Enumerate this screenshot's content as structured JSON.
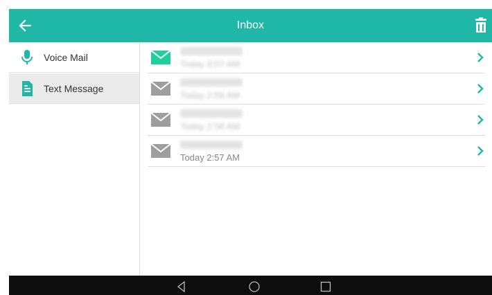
{
  "header": {
    "title": "Inbox",
    "back_icon": "arrow-left-icon",
    "delete_icon": "trash-icon"
  },
  "sidebar": {
    "items": [
      {
        "label": "Voice Mail",
        "icon": "microphone-icon",
        "active": false
      },
      {
        "label": "Text Message",
        "icon": "document-icon",
        "active": true
      }
    ]
  },
  "messages": [
    {
      "time": "Today 3:07 AM",
      "unread": true,
      "name_redacted": true,
      "time_redacted": true
    },
    {
      "time": "Today 2:59 AM",
      "unread": false,
      "name_redacted": true,
      "time_redacted": true
    },
    {
      "time": "Today 2:58 AM",
      "unread": false,
      "name_redacted": true,
      "time_redacted": true
    },
    {
      "time": "Today 2:57 AM",
      "unread": false,
      "name_redacted": true,
      "time_redacted": false
    }
  ],
  "navigation_bar": {
    "buttons": [
      "back-triangle-icon",
      "home-circle-icon",
      "recents-square-icon"
    ]
  },
  "colors": {
    "accent": "#1fb7a6",
    "read_envelope": "#9e9e9e",
    "nav_bar": "#0d0d0d"
  }
}
